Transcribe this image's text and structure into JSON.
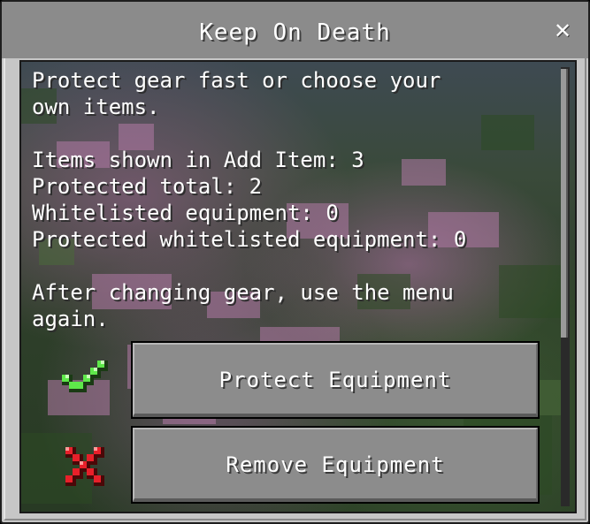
{
  "dialog": {
    "title": "Keep On Death",
    "close_icon": "close-icon",
    "close_glyph": "✕"
  },
  "body": {
    "intro_line1": "Protect gear fast or choose your",
    "intro_line2": "own items.",
    "stat_items_shown": "Items shown in Add Item: 3",
    "stat_protected_total": "Protected total: 2",
    "stat_whitelisted": "Whitelisted equipment: 0",
    "stat_protected_whitelisted": "Protected whitelisted equipment: 0",
    "note_line1": "After changing gear, use the menu",
    "note_line2": "again."
  },
  "actions": [
    {
      "label": "Protect Equipment",
      "icon": "green-checkmark-icon"
    },
    {
      "label": "Remove Equipment",
      "icon": "red-x-icon"
    }
  ],
  "colors": {
    "panel": "#c6c6c6",
    "title_bar": "#8b8b8b",
    "button": "#8c8c8c",
    "check_green": "#5ee84a",
    "cross_red": "#e8202a"
  }
}
